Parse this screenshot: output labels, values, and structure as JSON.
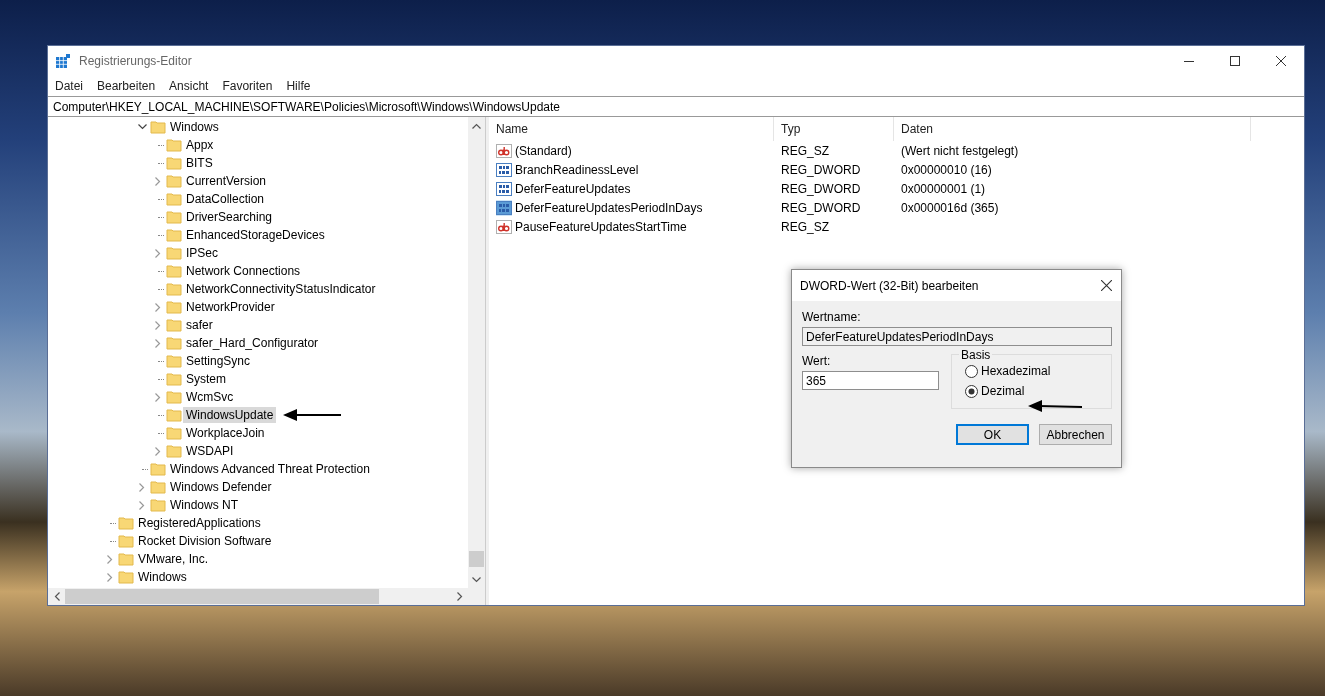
{
  "window": {
    "title": "Registrierungs-Editor"
  },
  "menu": [
    "Datei",
    "Bearbeiten",
    "Ansicht",
    "Favoriten",
    "Hilfe"
  ],
  "address": "Computer\\HKEY_LOCAL_MACHINE\\SOFTWARE\\Policies\\Microsoft\\Windows\\WindowsUpdate",
  "tree": {
    "items": [
      {
        "children": [
          {
            "children": [
              {
                "label": "Windows",
                "selected": false,
                "expanded": true,
                "children": [
                  {
                    "label": "Appx",
                    "selected": false
                  },
                  {
                    "label": "BITS",
                    "selected": false
                  },
                  {
                    "label": "CurrentVersion",
                    "selected": false,
                    "expanded": false
                  },
                  {
                    "label": "DataCollection",
                    "selected": false
                  },
                  {
                    "label": "DriverSearching",
                    "selected": false
                  },
                  {
                    "label": "EnhancedStorageDevices",
                    "selected": false
                  },
                  {
                    "label": "IPSec",
                    "selected": false,
                    "expanded": false
                  },
                  {
                    "label": "Network Connections",
                    "selected": false
                  },
                  {
                    "label": "NetworkConnectivityStatusIndicator",
                    "selected": false
                  },
                  {
                    "label": "NetworkProvider",
                    "selected": false,
                    "expanded": false
                  },
                  {
                    "label": "safer",
                    "selected": false,
                    "expanded": false
                  },
                  {
                    "label": "safer_Hard_Configurator",
                    "selected": false,
                    "expanded": false
                  },
                  {
                    "label": "SettingSync",
                    "selected": false
                  },
                  {
                    "label": "System",
                    "selected": false
                  },
                  {
                    "label": "WcmSvc",
                    "selected": false,
                    "expanded": false
                  },
                  {
                    "label": "WindowsUpdate",
                    "selected": true
                  },
                  {
                    "label": "WorkplaceJoin",
                    "selected": false
                  },
                  {
                    "label": "WSDAPI",
                    "selected": false,
                    "expanded": false
                  }
                ]
              },
              {
                "label": "Windows Advanced Threat Protection",
                "selected": false
              },
              {
                "label": "Windows Defender",
                "selected": false,
                "expanded": false
              },
              {
                "label": "Windows NT",
                "selected": false,
                "expanded": false
              }
            ]
          }
        ]
      },
      {
        "label": "RegisteredApplications",
        "selected": false
      },
      {
        "label": "Rocket Division Software",
        "selected": false
      },
      {
        "label": "VMware, Inc.",
        "selected": false,
        "expanded": false
      },
      {
        "label": "Windows",
        "selected": false,
        "expanded": false
      }
    ]
  },
  "values": {
    "columns": [
      "Name",
      "Typ",
      "Daten"
    ],
    "rows": [
      {
        "kind": "string",
        "name": "(Standard)",
        "type": "REG_SZ",
        "data": "(Wert nicht festgelegt)",
        "selected": false
      },
      {
        "kind": "dword",
        "name": "BranchReadinessLevel",
        "type": "REG_DWORD",
        "data": "0x00000010 (16)",
        "selected": false
      },
      {
        "kind": "dword",
        "name": "DeferFeatureUpdates",
        "type": "REG_DWORD",
        "data": "0x00000001 (1)",
        "selected": false
      },
      {
        "kind": "dword",
        "name": "DeferFeatureUpdatesPeriodInDays",
        "type": "REG_DWORD",
        "data": "0x0000016d (365)",
        "selected": true
      },
      {
        "kind": "string",
        "name": "PauseFeatureUpdatesStartTime",
        "type": "REG_SZ",
        "selected": false
      }
    ]
  },
  "dialog": {
    "title": "DWORD-Wert (32-Bit) bearbeiten",
    "name_label": "Wertname:",
    "name_value": "DeferFeatureUpdatesPeriodInDays",
    "value_label": "Wert:",
    "value": "365",
    "base": {
      "label": "Basis",
      "options": [
        {
          "label": "Hexadezimal",
          "selected": false
        },
        {
          "label": "Dezimal",
          "selected": true
        }
      ]
    },
    "buttons": [
      {
        "label": "OK",
        "default": true
      },
      {
        "label": "Abbrechen",
        "default": false
      }
    ]
  }
}
